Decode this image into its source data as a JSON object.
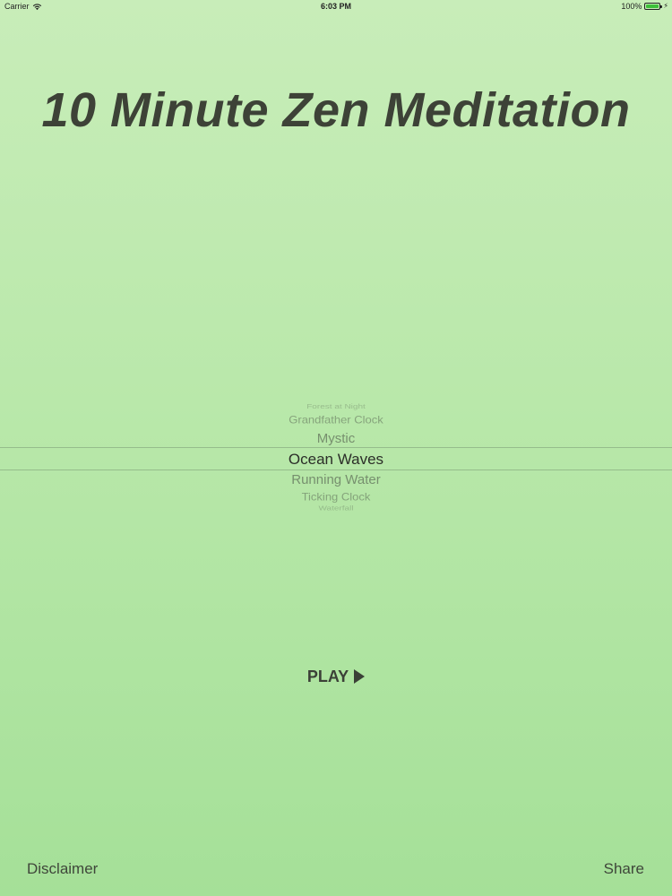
{
  "status_bar": {
    "carrier": "Carrier",
    "time": "6:03 PM",
    "battery_percent": "100%",
    "battery_level": 1.0,
    "icons": [
      "wifi-icon",
      "battery-icon",
      "charging-bolt-icon"
    ]
  },
  "title": "10 Minute Zen Meditation",
  "picker": {
    "items": [
      "Forest at Night",
      "Grandfather Clock",
      "Mystic",
      "Ocean Waves",
      "Running Water",
      "Ticking Clock",
      "Waterfall"
    ],
    "selected": "Ocean Waves"
  },
  "play": {
    "label": "PLAY",
    "icon": "play-triangle-icon"
  },
  "footer": {
    "disclaimer_label": "Disclaimer",
    "share_label": "Share"
  }
}
